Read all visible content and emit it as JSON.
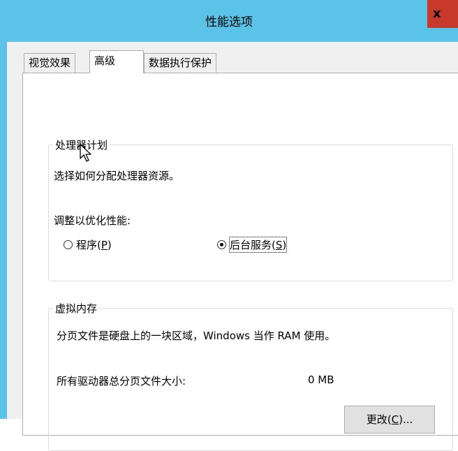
{
  "window": {
    "title": "性能选项",
    "close_label": "x"
  },
  "tabs": [
    {
      "label": "视觉效果",
      "active": false
    },
    {
      "label": "高级",
      "active": true
    },
    {
      "label": "数据执行保护",
      "active": false
    }
  ],
  "processor": {
    "group_title": "处理器计划",
    "description": "选择如何分配处理器资源。",
    "adjust_label": "调整以优化性能:",
    "option_programs": {
      "text": "程序(",
      "key": "P",
      "close": ")",
      "selected": false
    },
    "option_services": {
      "text": "后台服务(",
      "key": "S",
      "close": ")",
      "selected": true
    }
  },
  "virtual_memory": {
    "group_title": "虚拟内存",
    "description": "分页文件是硬盘上的一块区域，Windows 当作 RAM 使用。",
    "total_label": "所有驱动器总分页文件大小:",
    "total_value": "0 MB",
    "change_button": {
      "text": "更改(",
      "key": "C",
      "close": ")..."
    }
  },
  "colors": {
    "title_bar": "#5cc3e8",
    "close": "#c7392b"
  }
}
